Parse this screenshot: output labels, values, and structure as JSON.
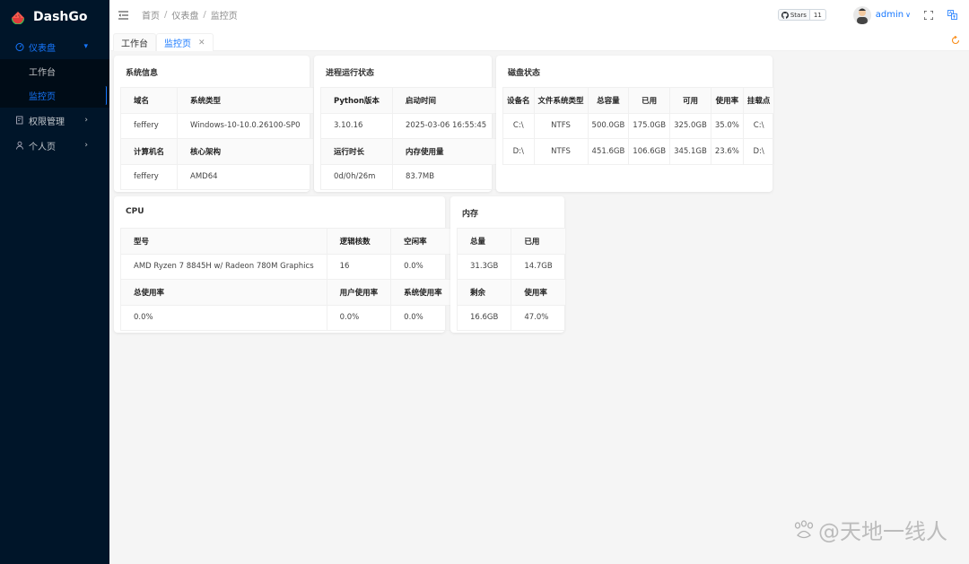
{
  "app": {
    "name": "DashGo"
  },
  "sidebar": {
    "items": [
      {
        "label": "仪表盘",
        "icon": "dashboard-icon",
        "expanded": true,
        "children": [
          {
            "label": "工作台"
          },
          {
            "label": "监控页"
          }
        ]
      },
      {
        "label": "权限管理",
        "icon": "audit-icon"
      },
      {
        "label": "个人页",
        "icon": "user-icon"
      }
    ]
  },
  "header": {
    "breadcrumb": [
      "首页",
      "仪表盘",
      "监控页"
    ],
    "github": {
      "label": "Stars",
      "count": "11"
    },
    "user": {
      "name": "admin"
    }
  },
  "tabs": [
    {
      "label": "工作台"
    },
    {
      "label": "监控页"
    }
  ],
  "watermark": "@天地一线人",
  "colors": {
    "accent": "#1677ff",
    "sidebar_bg": "#001529",
    "content_bg": "#f5f5f5"
  },
  "cards": {
    "sysinfo": {
      "title": "系统信息",
      "rows": [
        [
          "域名",
          "系统类型"
        ],
        [
          "feffery",
          "Windows-10-10.0.26100-SP0"
        ],
        [
          "计算机名",
          "核心架构"
        ],
        [
          "feffery",
          "AMD64"
        ]
      ]
    },
    "process": {
      "title": "进程运行状态",
      "rows": [
        [
          "Python版本",
          "启动时间"
        ],
        [
          "3.10.16",
          "2025-03-06 16:55:45"
        ],
        [
          "运行时长",
          "内存使用量"
        ],
        [
          "0d/0h/26m",
          "83.7MB"
        ]
      ]
    },
    "disk": {
      "title": "磁盘状态",
      "headers": [
        "设备名",
        "文件系统类型",
        "总容量",
        "已用",
        "可用",
        "使用率",
        "挂载点"
      ],
      "rows": [
        [
          "C:\\",
          "NTFS",
          "500.0GB",
          "175.0GB",
          "325.0GB",
          "35.0%",
          "C:\\"
        ],
        [
          "D:\\",
          "NTFS",
          "451.6GB",
          "106.6GB",
          "345.1GB",
          "23.6%",
          "D:\\"
        ]
      ]
    },
    "cpu": {
      "title": "CPU",
      "rows": [
        [
          "型号",
          "逻辑核数",
          "空闲率"
        ],
        [
          "AMD Ryzen 7 8845H w/ Radeon 780M Graphics",
          "16",
          "0.0%"
        ],
        [
          "总使用率",
          "用户使用率",
          "系统使用率"
        ],
        [
          "0.0%",
          "0.0%",
          "0.0%"
        ]
      ]
    },
    "memory": {
      "title": "内存",
      "rows": [
        [
          "总量",
          "已用"
        ],
        [
          "31.3GB",
          "14.7GB"
        ],
        [
          "剩余",
          "使用率"
        ],
        [
          "16.6GB",
          "47.0%"
        ]
      ]
    }
  }
}
